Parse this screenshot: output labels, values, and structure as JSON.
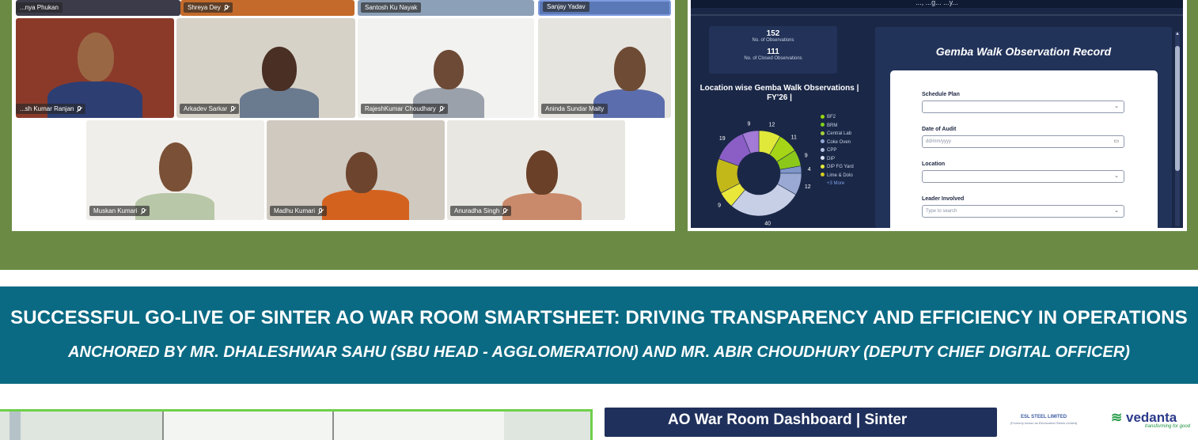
{
  "video_call": {
    "participants": [
      {
        "name": "...nya Phukan",
        "bg": "#3b3b4a"
      },
      {
        "name": "Shreya Dey",
        "bg": "#c46a2a"
      },
      {
        "name": "Santosh Ku Nayak",
        "bg": "#8ca0b8"
      },
      {
        "name": "Sanjay Yadav",
        "bg": "#5a78b5"
      },
      {
        "name": "...sh Kumar Ranjan",
        "bg": "#8b3a2a"
      },
      {
        "name": "Arkadev Sarkar",
        "bg": "#d7d2c8"
      },
      {
        "name": "RajeshKumar Choudhary",
        "bg": "#f2f2f0"
      },
      {
        "name": "Aninda Sundar Maity",
        "bg": "#e6e4df"
      },
      {
        "name": "Muskan Kumari",
        "bg": "#f0eeea"
      },
      {
        "name": "Madhu Kumari",
        "bg": "#cfc9c0"
      },
      {
        "name": "Anuradha Singh",
        "bg": "#e9e7e2"
      }
    ]
  },
  "dashboard": {
    "top_fragment": "..., ...g... ...y...",
    "observations_count": "152",
    "observations_label": "No. of Observations",
    "closed_count": "111",
    "closed_label": "No. of Closed Observations",
    "location_chart_title": "Location wise Gemba Walk Observations | FY'26 |",
    "legend": [
      {
        "label": "BF2",
        "color": "#9ad80f"
      },
      {
        "label": "BRM",
        "color": "#7fd11a"
      },
      {
        "label": "Central Lab",
        "color": "#a7d43b"
      },
      {
        "label": "Coke Oven",
        "color": "#93a9d8"
      },
      {
        "label": "CPP",
        "color": "#b8c4e2"
      },
      {
        "label": "DIP",
        "color": "#dfe6f5"
      },
      {
        "label": "DIP FG Yard",
        "color": "#e6e83a"
      },
      {
        "label": "Lime & Dolo",
        "color": "#d5cc1e"
      }
    ],
    "legend_more": "+3 More",
    "form_title": "Gemba Walk Observation Record",
    "fields": [
      {
        "label": "Schedule Plan",
        "placeholder": ""
      },
      {
        "label": "Date of Audit",
        "placeholder": "dd/mm/yyyy"
      },
      {
        "label": "Location",
        "placeholder": ""
      },
      {
        "label": "Leader Involved",
        "placeholder": "Type to search"
      }
    ]
  },
  "headline": "SUCCESSFUL GO-LIVE OF SINTER AO WAR ROOM SMARTSHEET: DRIVING TRANSPARENCY AND EFFICIENCY IN OPERATIONS",
  "subheadline": "ANCHORED BY MR. DHALESHWAR SAHU (SBU HEAD - AGGLOMERATION) AND MR. ABIR CHOUDHURY (DEPUTY CHIEF DIGITAL OFFICER)",
  "bottom_dashboard": {
    "title": "AO War Room Dashboard | Sinter",
    "esl_logo": "ESL STEEL LIMITED",
    "esl_sub": "(Formerly known as Electrosteel Steels Limited)",
    "vedanta_logo": "vedanta",
    "vedanta_tagline": "transforming for good"
  },
  "chart_data": {
    "type": "pie",
    "title": "Location wise Gemba Walk Observations | FY'26 |",
    "labels": [
      "12",
      "11",
      "9",
      "4",
      "12",
      "40",
      "9",
      "19",
      "19",
      "9"
    ],
    "values": [
      12,
      11,
      9,
      4,
      12,
      40,
      9,
      19,
      19,
      9
    ],
    "colors": [
      "#e0e83a",
      "#a6d417",
      "#8cc81a",
      "#7f96c9",
      "#9aa9d4",
      "#c7cfe6",
      "#eae73b",
      "#c3b81a",
      "#8a5ec5",
      "#a37ad6"
    ]
  }
}
